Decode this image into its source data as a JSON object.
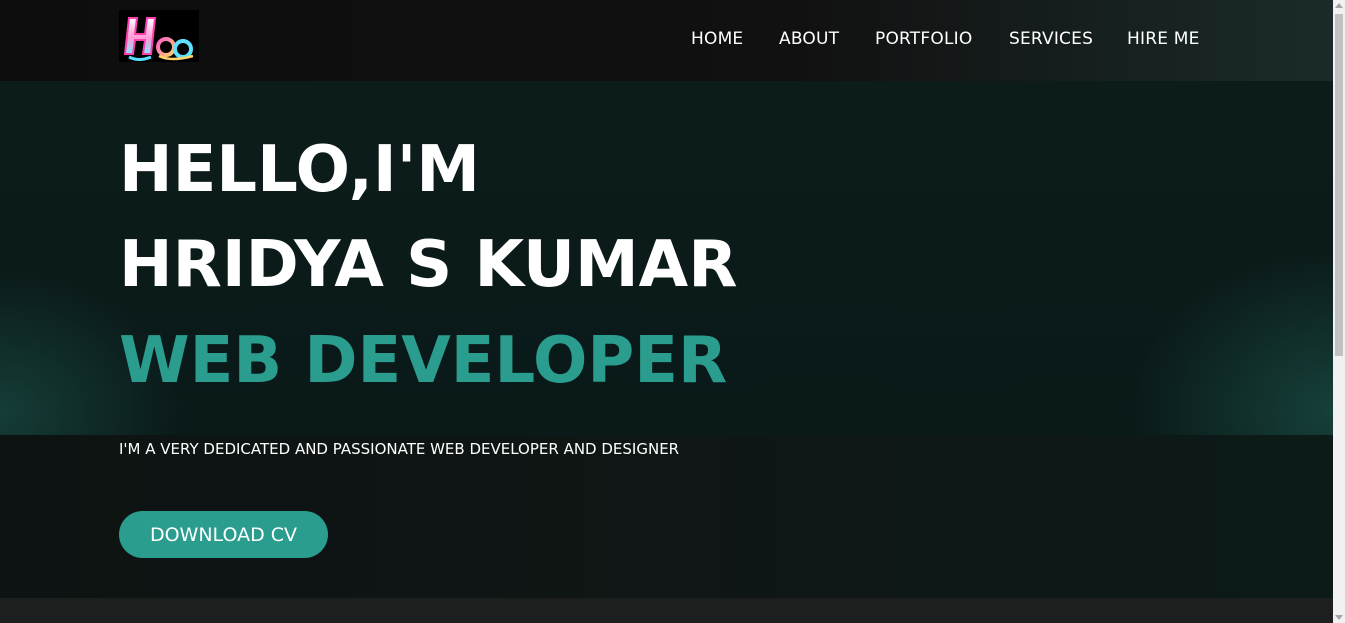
{
  "logo": {
    "icon": "hsk-logo-icon",
    "text": "Hsk"
  },
  "nav": {
    "items": [
      {
        "label": "HOME"
      },
      {
        "label": "ABOUT"
      },
      {
        "label": "PORTFOLIO"
      },
      {
        "label": "SERVICES"
      },
      {
        "label": "HIRE ME"
      }
    ]
  },
  "hero": {
    "line1": "HELLO,I'M",
    "line2": "HRIDYA S KUMAR",
    "line3": "WEB DEVELOPER",
    "tagline": "I'M A VERY DEDICATED AND PASSIONATE WEB DEVELOPER AND DESIGNER",
    "cta_label": "DOWNLOAD CV"
  },
  "colors": {
    "accent": "#2a9d8f",
    "nav_bg": "#111111",
    "hero_bg": "#0a1a19",
    "text": "#ffffff"
  }
}
